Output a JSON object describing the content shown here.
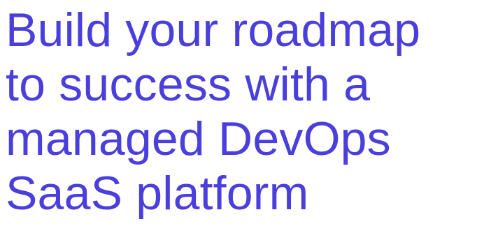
{
  "hero": {
    "heading_lines": [
      "Build your roadmap",
      "to success with a",
      "managed DevOps",
      "SaaS platform"
    ]
  },
  "colors": {
    "heading": "#4a3fdc",
    "background": "#ffffff"
  }
}
